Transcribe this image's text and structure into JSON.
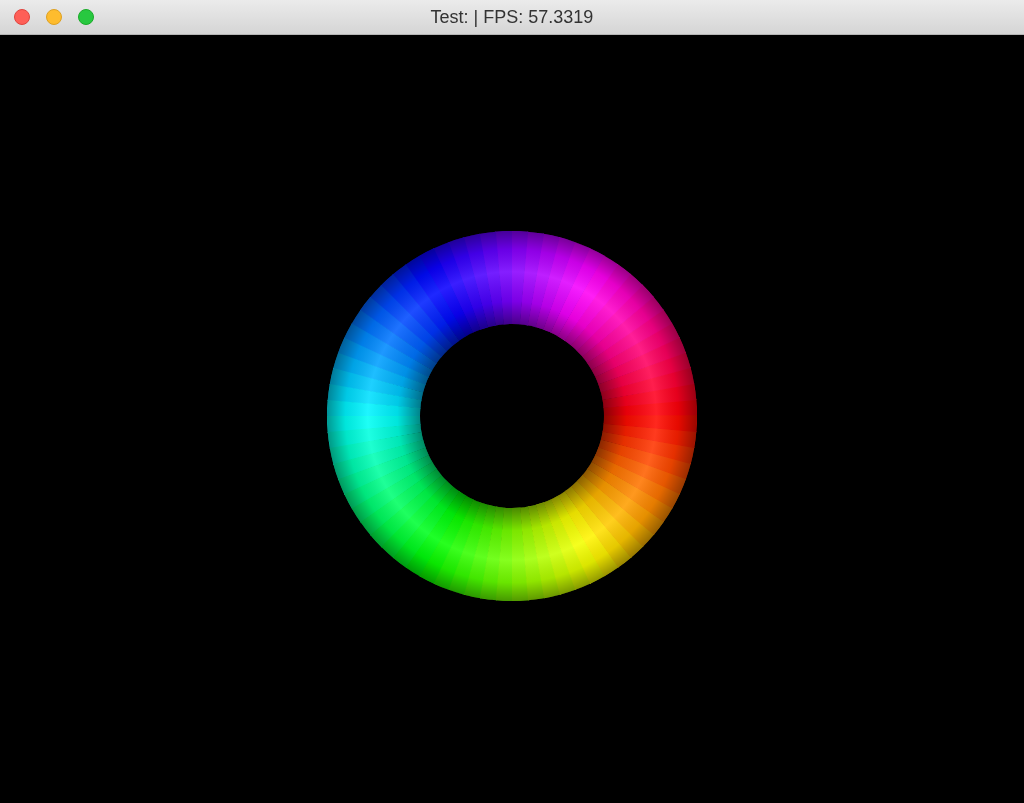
{
  "window": {
    "title": "Test: | FPS: 57.3319"
  }
}
